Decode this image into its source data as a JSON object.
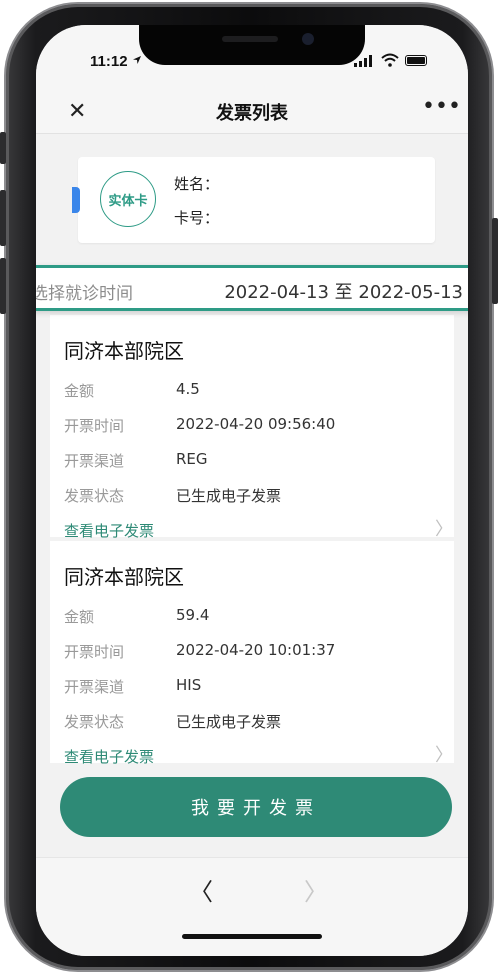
{
  "status_bar": {
    "time": "11:12"
  },
  "nav": {
    "close_icon": "close-icon",
    "title": "发票列表",
    "more_icon": "more-icon",
    "more_glyph": "•••"
  },
  "card": {
    "badge": "实体卡",
    "name_label": "姓名：",
    "card_no_label": "卡号："
  },
  "filter": {
    "label": "选择就诊时间",
    "range": "2022-04-13 至 2022-05-13"
  },
  "invoices": [
    {
      "hospital": "同济本部院区",
      "amount_label": "金额",
      "amount": "4.5",
      "time_label": "开票时间",
      "time": "2022-04-20 09:56:40",
      "channel_label": "开票渠道",
      "channel": "REG",
      "status_label": "发票状态",
      "status": "已生成电子发票",
      "link": "查看电子发票"
    },
    {
      "hospital": "同济本部院区",
      "amount_label": "金额",
      "amount": "59.4",
      "time_label": "开票时间",
      "time": "2022-04-20 10:01:37",
      "channel_label": "开票渠道",
      "channel": "HIS",
      "status_label": "发票状态",
      "status": "已生成电子发票",
      "link": "查看电子发票"
    }
  ],
  "primary_button": "我要开发票",
  "toolbar": {
    "back_icon": "chevron-left-icon",
    "forward_icon": "chevron-right-icon"
  },
  "colors": {
    "accent": "#2e8a76",
    "flag": "#3a86ea"
  }
}
